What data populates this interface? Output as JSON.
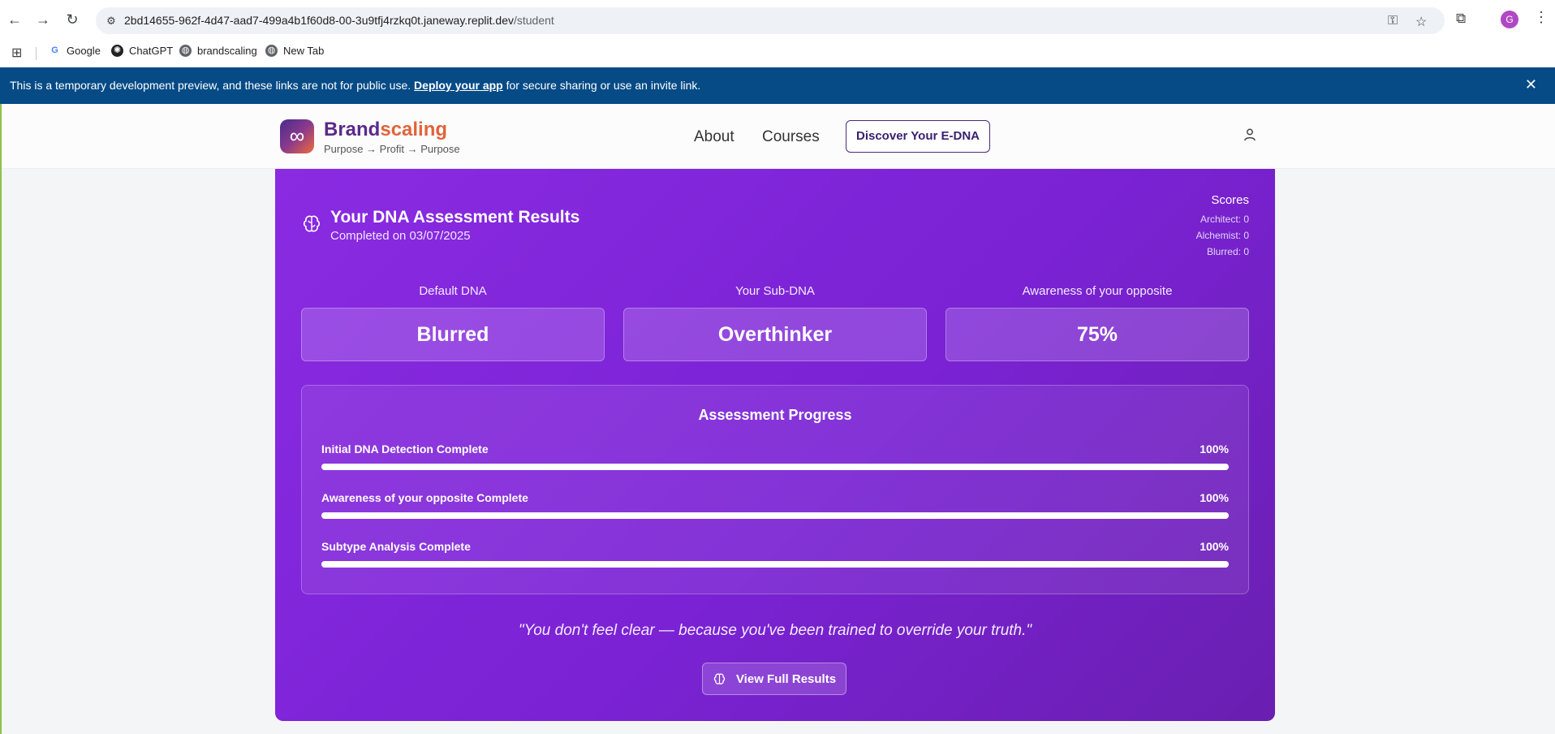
{
  "browser": {
    "url_host": "2bd14655-962f-4d47-aad7-499a4b1f60d8-00-3u9tfj4rzkq0t.janeway.replit.dev",
    "url_path": "/student",
    "profile_initial": "G",
    "bookmarks": [
      {
        "label": "Google"
      },
      {
        "label": "ChatGPT"
      },
      {
        "label": "brandscaling"
      },
      {
        "label": "New Tab"
      }
    ]
  },
  "banner": {
    "text_before": "This is a temporary development preview, and these links are not for public use. ",
    "link": "Deploy your app",
    "text_after": " for secure sharing or use an invite link."
  },
  "site": {
    "logo_glyph": "∞",
    "brand_part1": "Brand",
    "brand_part2": "scaling",
    "tagline": "Purpose → Profit → Purpose",
    "nav": [
      "About",
      "Courses"
    ],
    "cta": "Discover Your E-DNA"
  },
  "results": {
    "title": "Your DNA Assessment Results",
    "completed": "Completed on 03/07/2025",
    "scores": {
      "heading": "Scores",
      "architect": "Architect: 0",
      "alchemist": "Alchemist: 0",
      "blurred": "Blurred: 0"
    },
    "cards": [
      {
        "label": "Default DNA",
        "value": "Blurred"
      },
      {
        "label": "Your Sub-DNA",
        "value": "Overthinker"
      },
      {
        "label": "Awareness of your opposite",
        "value": "75%"
      }
    ],
    "progress": {
      "title": "Assessment Progress",
      "items": [
        {
          "label": "Initial DNA Detection Complete",
          "value": "100%",
          "fraction": 1.0
        },
        {
          "label": "Awareness of your opposite Complete",
          "value": "100%",
          "fraction": 1.0
        },
        {
          "label": "Subtype Analysis Complete",
          "value": "100%",
          "fraction": 1.0
        }
      ]
    },
    "quote": "\"You don't feel clear — because you've been trained to override your truth.\"",
    "view_button": "View Full Results"
  },
  "colors": {
    "banner": "#064b86",
    "card_gradient_start": "#8a2be2",
    "card_gradient_end": "#6a1fb0",
    "brand_purple": "#5a2a8a",
    "brand_orange": "#e0643a"
  }
}
